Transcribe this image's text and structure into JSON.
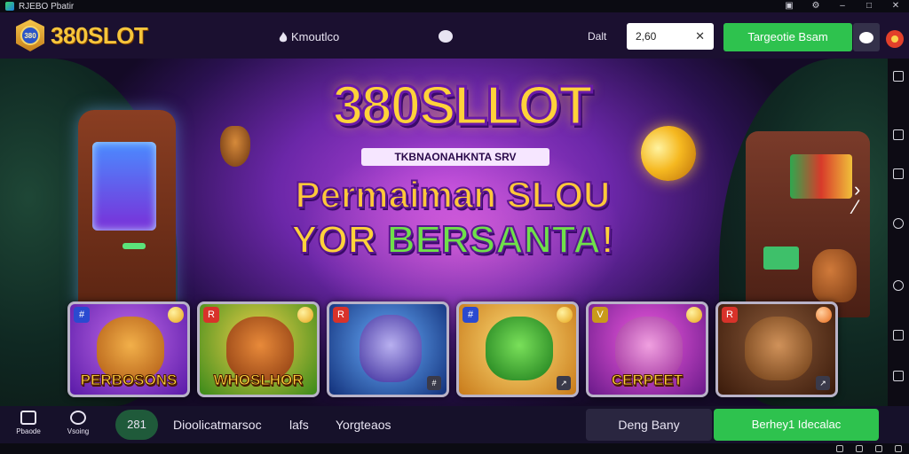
{
  "os_window": {
    "title": "RJEBO Pbatir"
  },
  "header": {
    "brand": "380SLOT",
    "logo_text": "380",
    "nav_link": "Kmoutlco",
    "balance_label": "Dalt",
    "balance_value": "2,60",
    "login_button": "Targeotie Bsam"
  },
  "hero": {
    "title": "380SLLOT",
    "tagline": "TKBNAONAHKNTA SRV",
    "line1": "Permaiman SLOU",
    "line2_part1": "YOR ",
    "line2_part2": "BERSANTA",
    "line2_part3": "!"
  },
  "games": [
    {
      "label": "PERBOSONS",
      "badge": "#",
      "badge_color": "#2a4ad0",
      "face_color": "#e0902a",
      "bg": "#8a3ed0"
    },
    {
      "label": "WHOSLHOR",
      "badge": "R",
      "badge_color": "#d8322a",
      "face_color": "#d07030",
      "bg": "#3aa02a"
    },
    {
      "label": "",
      "badge": "R",
      "badge_color": "#d8322a",
      "face_color": "#6a5ad8",
      "bg": "#1a5ac8"
    },
    {
      "label": "",
      "badge": "#",
      "badge_color": "#2a4ad0",
      "face_color": "#3ac03a",
      "bg": "#e09a2a"
    },
    {
      "label": "CERPEET",
      "badge": "V",
      "badge_color": "#c99a1a",
      "face_color": "#d06ac8",
      "bg": "#a02ab0"
    },
    {
      "label": "",
      "badge": "R",
      "badge_color": "#d8322a",
      "face_color": "#b07040",
      "bg": "#7a3a1a"
    }
  ],
  "bottom_bar": {
    "home_label": "Pbaode",
    "settings_label": "Vsoing",
    "pill_label": "281",
    "link1": "Dioolicatmarsoc",
    "link2": "lafs",
    "link3": "Yorgteaos",
    "outline_button": "Deng Bany",
    "green_button": "Berhey1 Idecalac"
  }
}
